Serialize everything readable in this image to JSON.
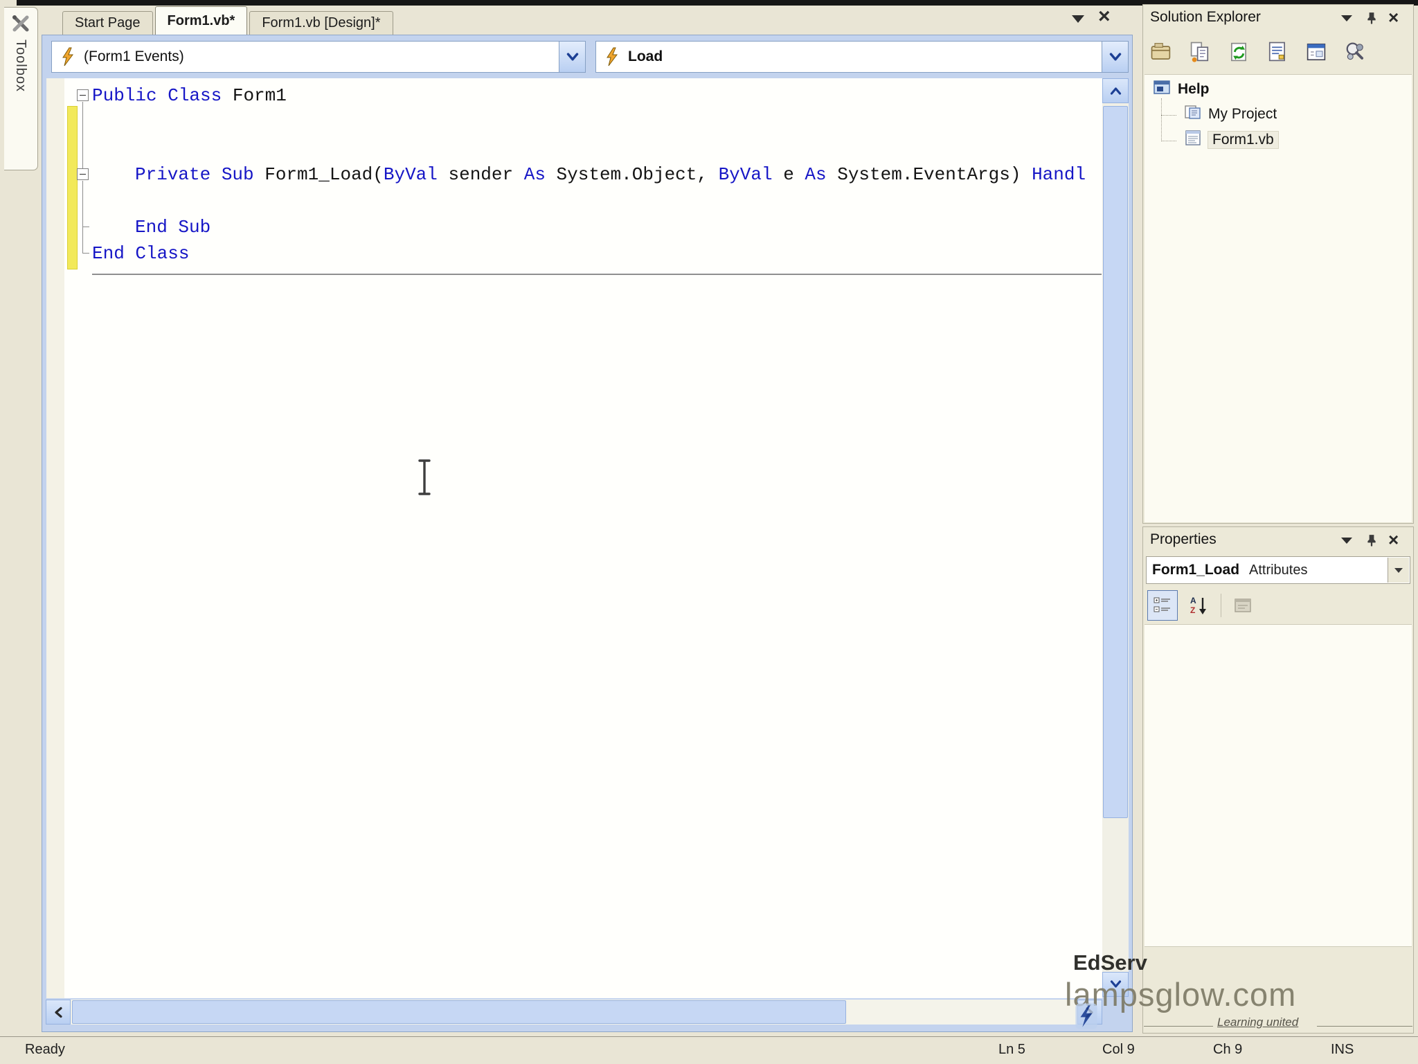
{
  "colors": {
    "keyword_blue": "#1616c6",
    "xp_beige": "#ece9d8",
    "frame_blue": "#c3d3ee",
    "scroll_thumb": "#c6d7f4",
    "edit_tracking_yellow": "#f2e95a"
  },
  "toolbox": {
    "label": "Toolbox",
    "icon": "tools-icon"
  },
  "tabs": [
    {
      "label": "Start Page"
    },
    {
      "label": "Form1.vb*"
    },
    {
      "label": "Form1.vb [Design]*"
    }
  ],
  "nav": {
    "left_value": "(Form1 Events)",
    "right_value": "Load",
    "icon": "event-lightning-icon"
  },
  "code": {
    "line1": {
      "kw": "Public Class",
      "id": " Form1"
    },
    "line4": {
      "kw1": "Private Sub",
      "id1": " Form1_Load(",
      "kw2": "ByVal",
      "id2": " sender ",
      "kw3": "As",
      "id3": " System.Object, ",
      "kw4": "ByVal",
      "id4": " e ",
      "kw5": "As",
      "id5": " System.EventArgs) ",
      "kw6": "Handl"
    },
    "line6": {
      "kw": "End Sub"
    },
    "line7": {
      "kw": "End Class"
    }
  },
  "solution_explorer": {
    "title": "Solution Explorer",
    "toolbar_icons": [
      "properties-icon",
      "show-all-files-icon",
      "refresh-icon",
      "view-code-icon",
      "view-designer-icon",
      "view-class-diagram-icon"
    ],
    "tree": {
      "root": "Help",
      "items": [
        {
          "label": "My Project"
        },
        {
          "label": "Form1.vb"
        }
      ]
    }
  },
  "properties_panel": {
    "title": "Properties",
    "object_name": "Form1_Load",
    "object_type": "Attributes",
    "toolbar_icons": [
      "categorized-icon",
      "alphabetical-sort-icon",
      "property-pages-icon"
    ]
  },
  "status_bar": {
    "state": "Ready",
    "line": "Ln 5",
    "column": "Col 9",
    "character": "Ch 9",
    "mode": "INS"
  },
  "watermark": {
    "brand": "EdServ",
    "site": "lampsglow.com",
    "tagline": "Learning united"
  }
}
